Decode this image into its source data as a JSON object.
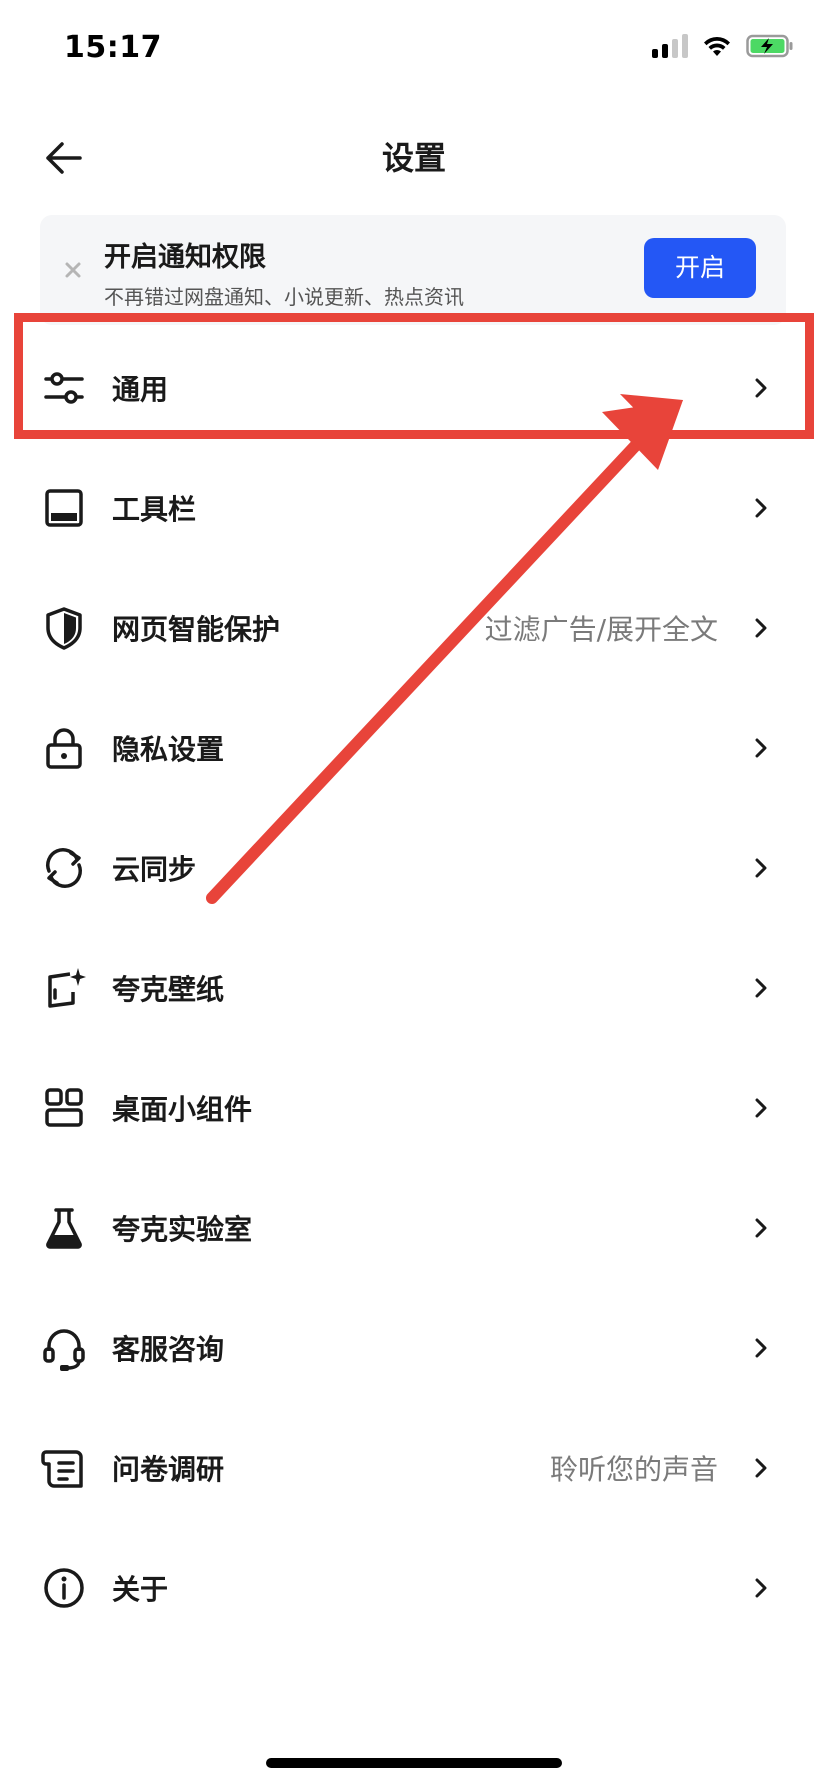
{
  "status_bar": {
    "time": "15:17"
  },
  "header": {
    "title": "设置"
  },
  "banner": {
    "title": "开启通知权限",
    "subtitle": "不再错过网盘通知、小说更新、热点资讯",
    "button_label": "开启"
  },
  "menu": [
    {
      "label": "通用",
      "hint": "",
      "icon": "sliders-icon"
    },
    {
      "label": "工具栏",
      "hint": "",
      "icon": "toolbar-icon"
    },
    {
      "label": "网页智能保护",
      "hint": "过滤广告/展开全文",
      "icon": "shield-icon"
    },
    {
      "label": "隐私设置",
      "hint": "",
      "icon": "lock-icon"
    },
    {
      "label": "云同步",
      "hint": "",
      "icon": "sync-icon"
    },
    {
      "label": "夸克壁纸",
      "hint": "",
      "icon": "wallpaper-icon"
    },
    {
      "label": "桌面小组件",
      "hint": "",
      "icon": "widgets-icon"
    },
    {
      "label": "夸克实验室",
      "hint": "",
      "icon": "flask-icon"
    },
    {
      "label": "客服咨询",
      "hint": "",
      "icon": "headset-icon"
    },
    {
      "label": "问卷调研",
      "hint": "聆听您的声音",
      "icon": "survey-icon"
    },
    {
      "label": "关于",
      "hint": "",
      "icon": "info-icon"
    }
  ],
  "colors": {
    "accent": "#2457f5",
    "highlight": "#e8443a",
    "battery": "#4cd964"
  }
}
